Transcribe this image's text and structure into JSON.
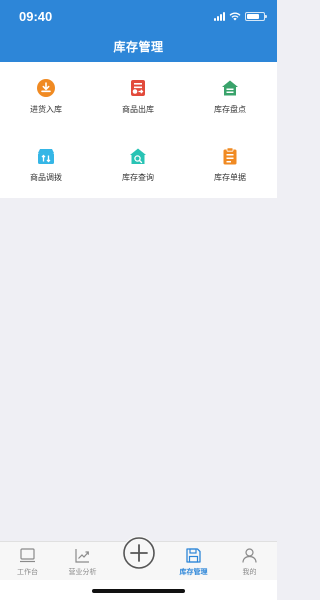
{
  "status_bar": {
    "time": "09:40"
  },
  "header": {
    "title": "库存管理"
  },
  "menu": [
    {
      "label": "进货入库",
      "icon": "stock-in-icon",
      "color": "#f08a22"
    },
    {
      "label": "商品出库",
      "icon": "stock-out-icon",
      "color": "#e24a3b"
    },
    {
      "label": "库存盘点",
      "icon": "inventory-check-icon",
      "color": "#3aa36b"
    },
    {
      "label": "商品调拨",
      "icon": "transfer-icon",
      "color": "#35b6e6"
    },
    {
      "label": "库存查询",
      "icon": "inventory-search-icon",
      "color": "#28c3b4"
    },
    {
      "label": "库存单据",
      "icon": "inventory-document-icon",
      "color": "#f08a22"
    }
  ],
  "tabbar": {
    "active_color": "#2d86d8",
    "items": [
      {
        "label": "工作台",
        "icon": "workbench-icon"
      },
      {
        "label": "营业分析",
        "icon": "analysis-icon"
      },
      {
        "label": "",
        "icon": "plus-circle-icon"
      },
      {
        "label": "库存管理",
        "icon": "inventory-save-icon",
        "active": true
      },
      {
        "label": "我的",
        "icon": "user-icon"
      }
    ]
  }
}
